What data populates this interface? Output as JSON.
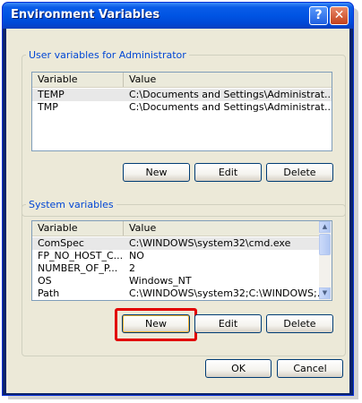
{
  "window": {
    "title": "Environment Variables",
    "help_label": "?",
    "close_label": "✕"
  },
  "user_vars": {
    "legend": "User variables for Administrator",
    "headers": {
      "variable": "Variable",
      "value": "Value"
    },
    "rows": [
      {
        "variable": "TEMP",
        "value": "C:\\Documents and Settings\\Administrat..."
      },
      {
        "variable": "TMP",
        "value": "C:\\Documents and Settings\\Administrat..."
      }
    ],
    "buttons": {
      "new": "New",
      "edit": "Edit",
      "delete": "Delete"
    }
  },
  "system_vars": {
    "legend": "System variables",
    "headers": {
      "variable": "Variable",
      "value": "Value"
    },
    "rows": [
      {
        "variable": "ComSpec",
        "value": "C:\\WINDOWS\\system32\\cmd.exe"
      },
      {
        "variable": "FP_NO_HOST_C...",
        "value": "NO"
      },
      {
        "variable": "NUMBER_OF_P...",
        "value": "2"
      },
      {
        "variable": "OS",
        "value": "Windows_NT"
      },
      {
        "variable": "Path",
        "value": "C:\\WINDOWS\\system32;C:\\WINDOWS;..."
      }
    ],
    "buttons": {
      "new": "New",
      "edit": "Edit",
      "delete": "Delete"
    }
  },
  "footer": {
    "ok": "OK",
    "cancel": "Cancel"
  },
  "colors": {
    "highlight": "#e20000",
    "title_bar": "#0054e3",
    "legend": "#0046d5"
  }
}
